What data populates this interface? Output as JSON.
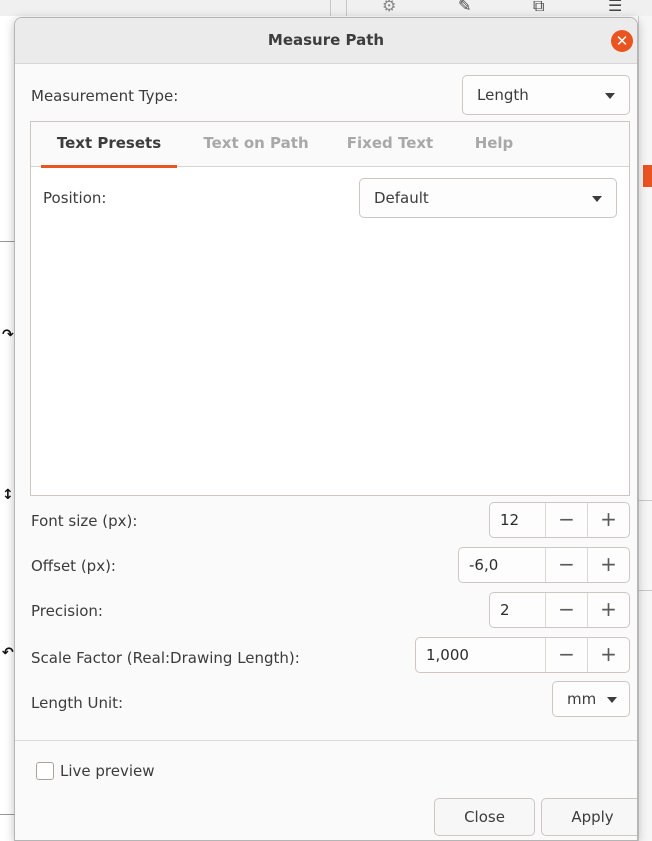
{
  "background": {
    "toolbar_icons": [
      "gear-icon",
      "pen-icon",
      "code-icon",
      "stack-icon"
    ]
  },
  "dialog": {
    "title": "Measure Path",
    "close_icon": "close-icon",
    "accent_color": "#e95420",
    "measurement_type": {
      "label": "Measurement Type:",
      "value": "Length"
    },
    "tabs": [
      {
        "label": "Text Presets",
        "active": true
      },
      {
        "label": "Text on Path",
        "active": false
      },
      {
        "label": "Fixed Text",
        "active": false
      },
      {
        "label": "Help",
        "active": false
      }
    ],
    "position": {
      "label": "Position:",
      "value": "Default"
    },
    "fields": {
      "font_size": {
        "label": "Font size (px):",
        "value": "12"
      },
      "offset": {
        "label": "Offset (px):",
        "value": "-6,0"
      },
      "precision": {
        "label": "Precision:",
        "value": "2"
      },
      "scale_factor": {
        "label": "Scale Factor (Real:Drawing Length):",
        "value": "1,000"
      }
    },
    "spin_buttons": {
      "minus": "−",
      "plus": "+"
    },
    "length_unit": {
      "label": "Length Unit:",
      "value": "mm"
    },
    "live_preview": {
      "label": "Live preview",
      "checked": false
    },
    "buttons": {
      "close": "Close",
      "apply": "Apply"
    }
  }
}
